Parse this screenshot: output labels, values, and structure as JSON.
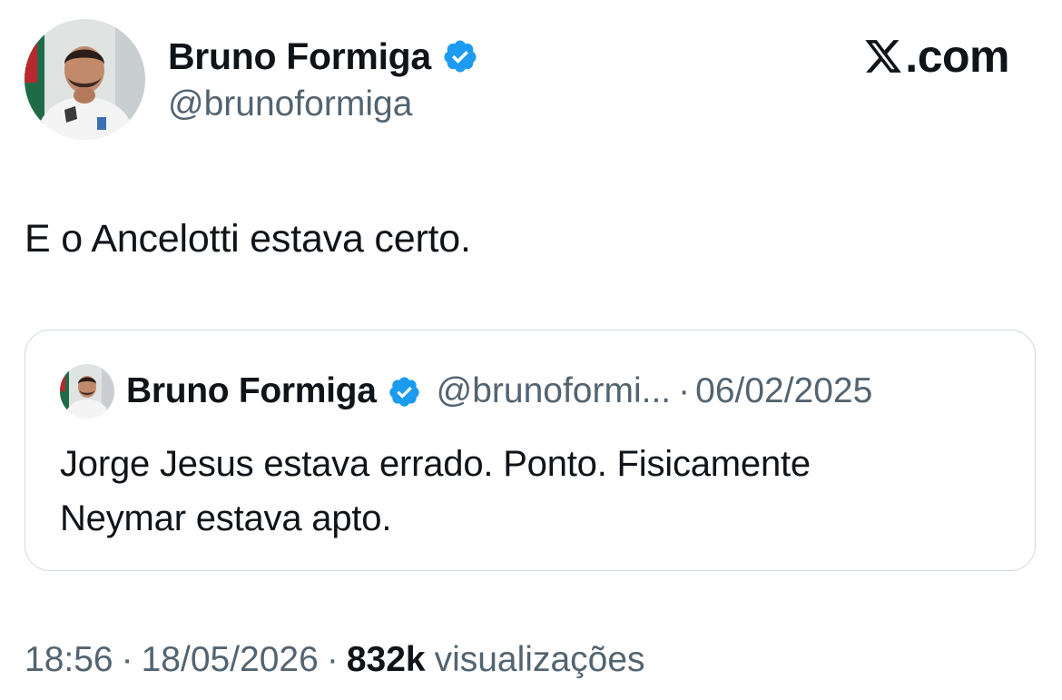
{
  "tweet": {
    "author_name": "Bruno Formiga",
    "author_handle": "@brunoformiga",
    "verified_icon": "verified-badge-icon",
    "text": "E o Ancelotti estava certo.",
    "time": "18:56",
    "date": "18/05/2026",
    "views_count": "832k",
    "views_label": "visualizações",
    "separator": "·"
  },
  "brand": {
    "label": ".com",
    "icon": "x-logo-icon"
  },
  "quote": {
    "author_name": "Bruno Formiga",
    "author_handle": "@brunoformi...",
    "separator": "·",
    "date": "06/02/2025",
    "text_line1": "Jorge Jesus estava errado. Ponto. Fisicamente",
    "text_line2": "Neymar estava apto."
  },
  "colors": {
    "text_primary": "#0f1419",
    "text_secondary": "#536471",
    "verified_blue": "#1d9bf0",
    "border": "#cfd9de"
  }
}
